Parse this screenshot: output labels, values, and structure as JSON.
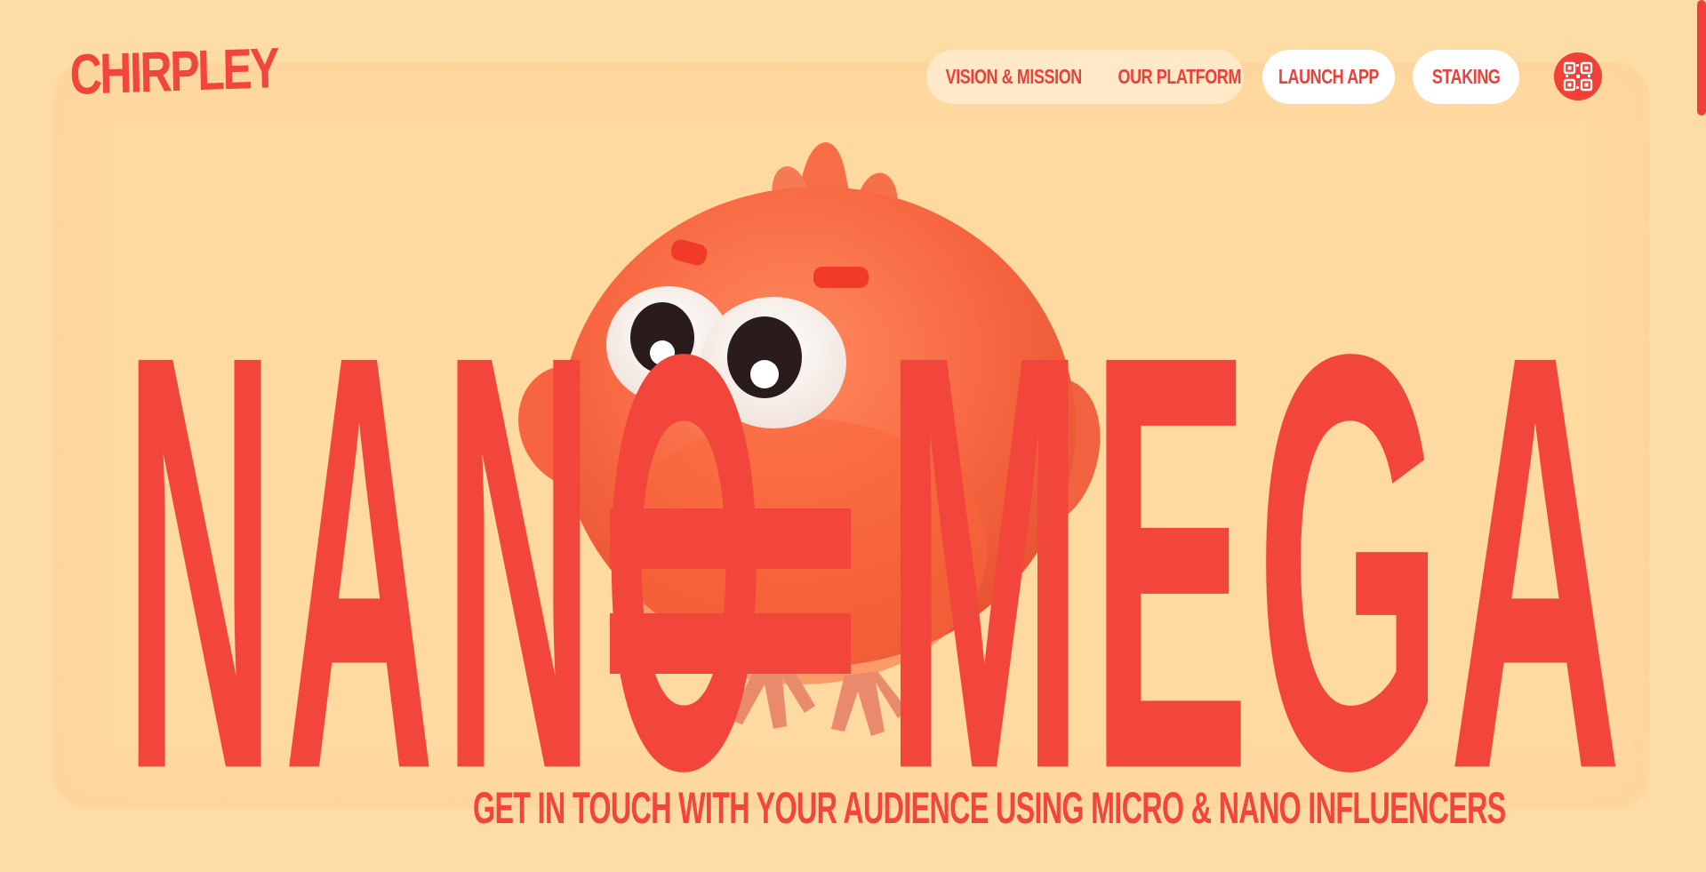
{
  "brand": {
    "logo_text": "CHIRPLEY",
    "accent_color": "#f2453c",
    "background_color": "#fedca6"
  },
  "nav": {
    "links": [
      {
        "label": "VISION & MISSION"
      },
      {
        "label": "OUR PLATFORM"
      }
    ],
    "launch_label": "LAUNCH APP",
    "staking_label": "STAKING",
    "qr_icon": "qr-code-icon"
  },
  "hero": {
    "word_left": "NANO",
    "word_right": "MEGA",
    "equals_icon": "equals-sign",
    "mascot": "bird-mascot",
    "tagline": "GET IN TOUCH WITH YOUR AUDIENCE USING MICRO & NANO INFLUENCERS"
  }
}
